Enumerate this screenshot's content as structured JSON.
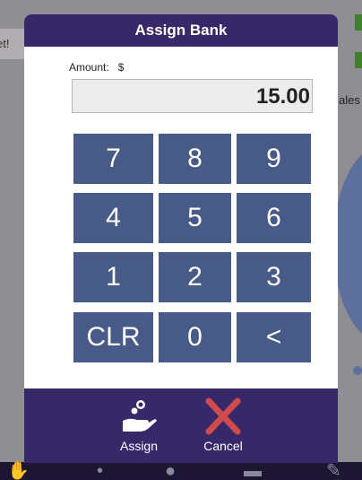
{
  "background": {
    "banner_text": "et!",
    "snippet_text": "ales b"
  },
  "modal": {
    "title": "Assign Bank",
    "amount_label": "Amount:",
    "currency_symbol": "$",
    "amount_value": "15.00",
    "keys": [
      "7",
      "8",
      "9",
      "4",
      "5",
      "6",
      "1",
      "2",
      "3",
      "CLR",
      "0",
      "<"
    ]
  },
  "footer": {
    "assign_label": "Assign",
    "assign_icon": "hand-coins-icon",
    "cancel_label": "Cancel",
    "cancel_icon": "close-x-icon"
  },
  "colors": {
    "header": "#37286a",
    "key": "#475a88",
    "cancel": "#d04b4b"
  }
}
